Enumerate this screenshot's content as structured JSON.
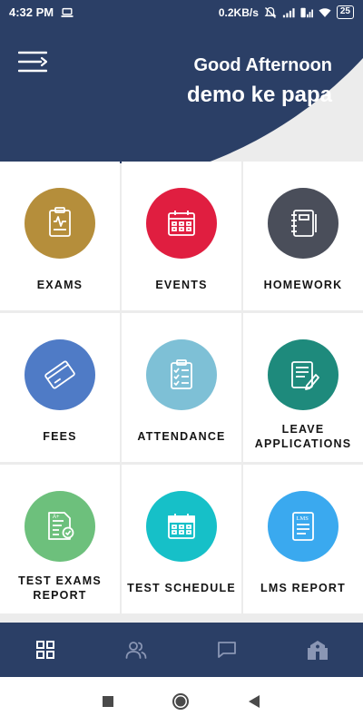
{
  "status_bar": {
    "time": "4:32 PM",
    "network_speed": "0.2KB/s",
    "battery": "25",
    "icons": [
      "laptop-icon",
      "mute-icon",
      "signal-icon",
      "volte-signal-icon",
      "wifi-icon",
      "battery-icon"
    ]
  },
  "header": {
    "greeting": "Good Afternoon",
    "user_name": "demo ke papa",
    "menu_icon": "menu-icon",
    "colors": {
      "header_bg": "#2b3f66",
      "page_bg": "#ececec"
    }
  },
  "tiles": [
    {
      "label": "EXAMS",
      "icon": "exam-icon",
      "color": "#b58e3b"
    },
    {
      "label": "EVENTS",
      "icon": "calendar-icon",
      "color": "#e01e40"
    },
    {
      "label": "HOMEWORK",
      "icon": "notebook-icon",
      "color": "#4a4e5a"
    },
    {
      "label": "FEES",
      "icon": "credit-card-icon",
      "color": "#4f7bc6"
    },
    {
      "label": "ATTENDANCE",
      "icon": "clipboard-checklist-icon",
      "color": "#7ec0d6"
    },
    {
      "label": "LEAVE APPLICATIONS",
      "icon": "document-edit-icon",
      "color": "#1e8a7c"
    },
    {
      "label": "TEST EXAMS REPORT",
      "icon": "report-icon",
      "color": "#6dc07c"
    },
    {
      "label": "TEST SCHEDULE",
      "icon": "schedule-calendar-icon",
      "color": "#16c0c8"
    },
    {
      "label": "LMS REPORT",
      "icon": "lms-report-icon",
      "color": "#3aa9ef"
    }
  ],
  "bottom_nav": [
    {
      "icon": "dashboard-grid-icon",
      "active": true
    },
    {
      "icon": "users-icon",
      "active": false
    },
    {
      "icon": "chat-icon",
      "active": false
    },
    {
      "icon": "school-icon",
      "active": false
    }
  ],
  "system_nav": [
    "recents-button",
    "home-button",
    "back-button"
  ]
}
